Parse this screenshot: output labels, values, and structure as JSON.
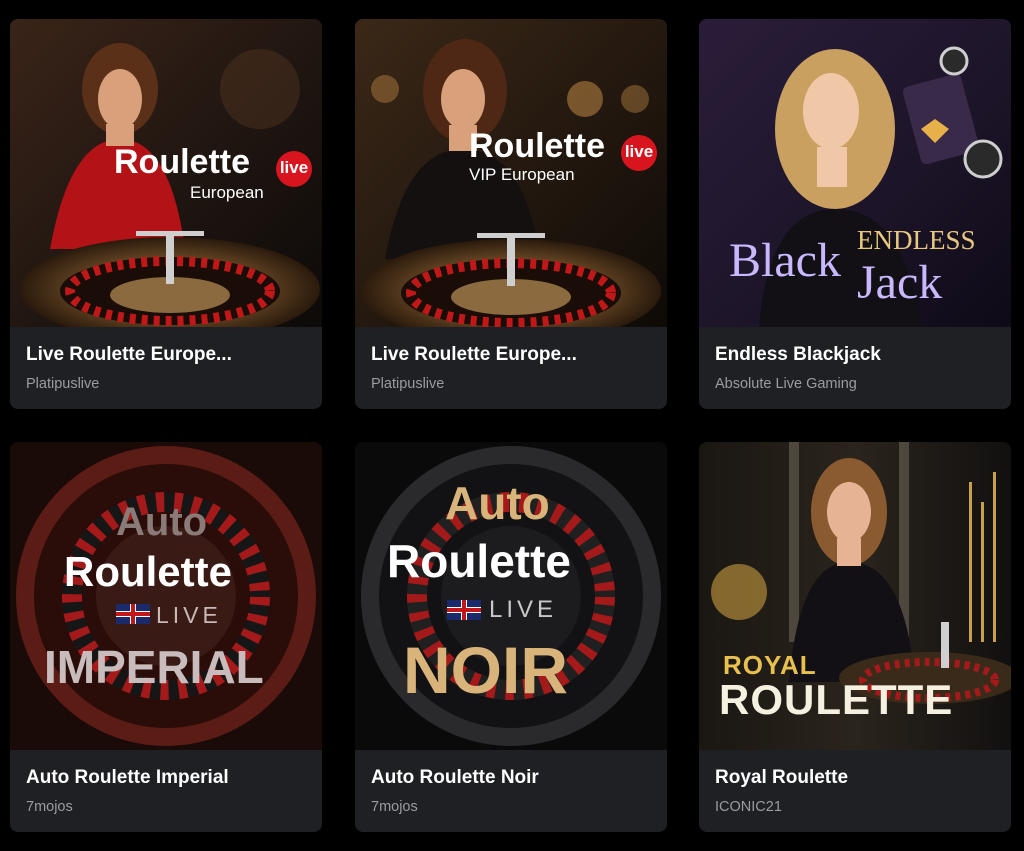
{
  "games": [
    {
      "title": "Live Roulette Europe...",
      "provider": "Platipuslive",
      "art": {
        "logo_main": "Roulette",
        "logo_badge": "live",
        "logo_sub": "European"
      }
    },
    {
      "title": "Live Roulette Europe...",
      "provider": "Platipuslive",
      "art": {
        "logo_main": "Roulette",
        "logo_badge": "live",
        "logo_sub": "VIP European"
      }
    },
    {
      "title": "Endless Blackjack",
      "provider": "Absolute Live Gaming",
      "art": {
        "logo_top": "ENDLESS",
        "logo_main": "Black",
        "logo_main2": "Jack"
      }
    },
    {
      "title": "Auto Roulette Imperial",
      "provider": "7mojos",
      "art": {
        "logo_top": "Auto",
        "logo_main": "Roulette",
        "logo_badge": "LIVE",
        "logo_sub": "IMPERIAL"
      }
    },
    {
      "title": "Auto Roulette Noir",
      "provider": "7mojos",
      "art": {
        "logo_top": "Auto",
        "logo_main": "Roulette",
        "logo_badge": "LIVE",
        "logo_sub": "NOIR"
      }
    },
    {
      "title": "Royal Roulette",
      "provider": "ICONIC21",
      "art": {
        "logo_top": "ROYAL",
        "logo_main": "ROULETTE"
      }
    }
  ],
  "colors": {
    "page_bg": "#000000",
    "card_bg": "#1e2024",
    "title": "#ffffff",
    "provider": "#9a9ca2",
    "live_badge": "#d8151f",
    "gold": "#d9b47a",
    "lavender": "#c9b8ff"
  }
}
